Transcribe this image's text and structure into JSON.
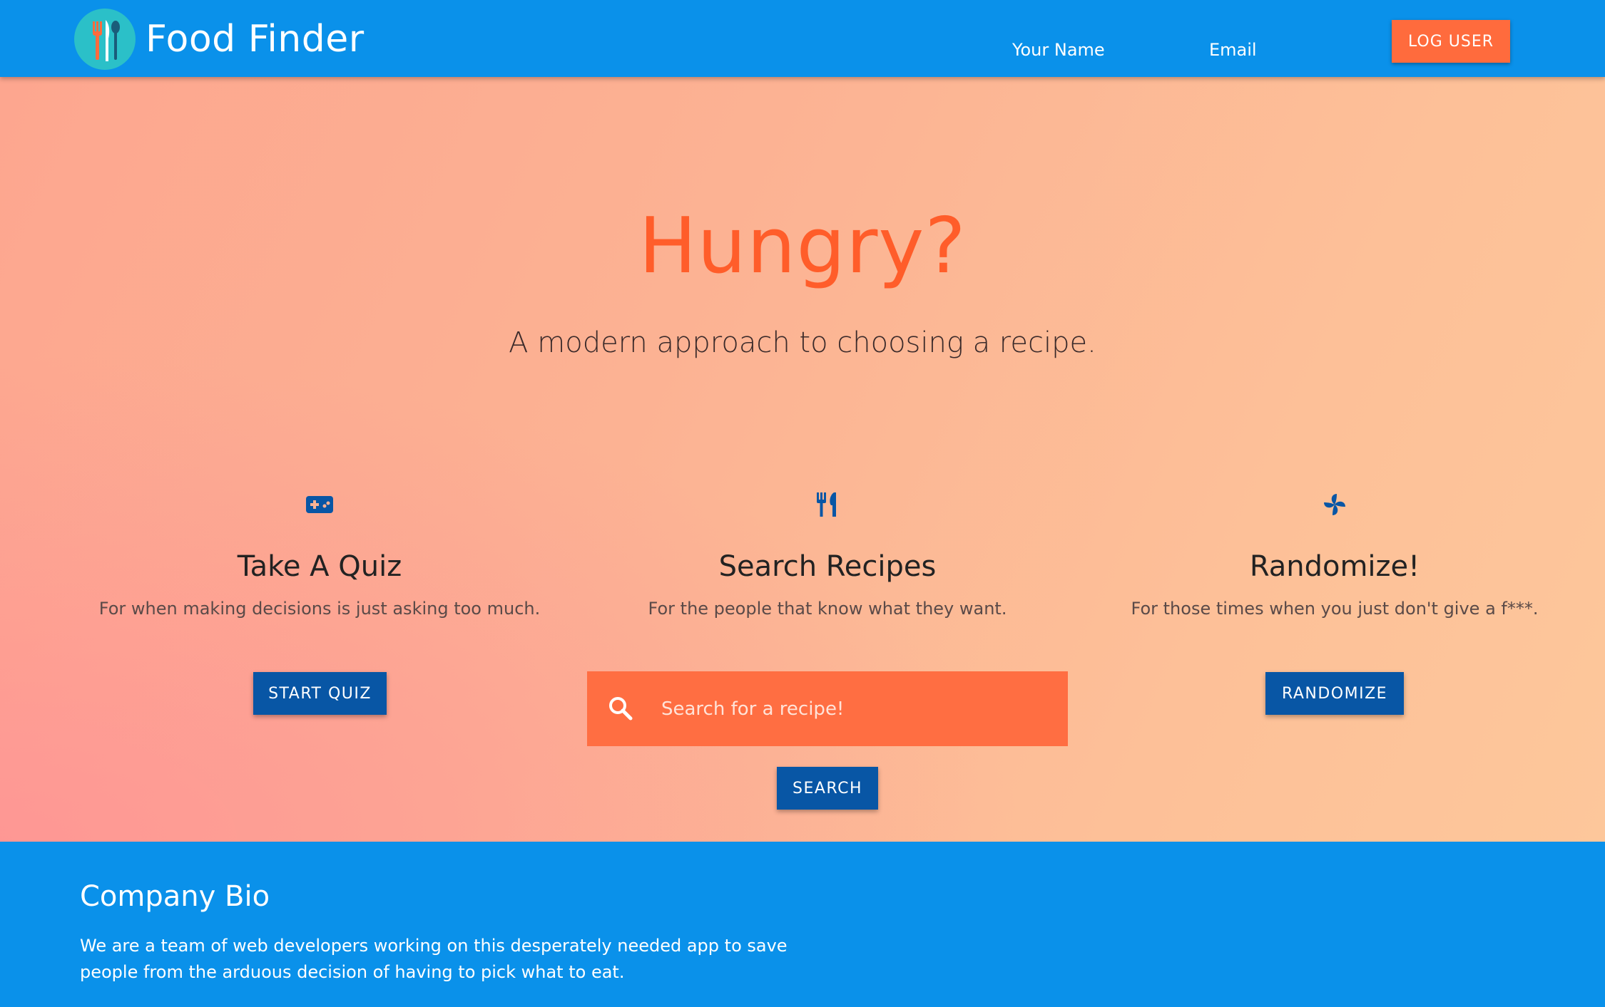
{
  "navbar": {
    "brand_name": "Food Finder",
    "name_placeholder": "Your Name",
    "email_placeholder": "Email",
    "log_button": "LOG USER"
  },
  "hero": {
    "title": "Hungry?",
    "subtitle": "A modern approach to choosing a recipe."
  },
  "features": {
    "quiz": {
      "icon": "gamepad-icon",
      "title": "Take A Quiz",
      "description": "For when making decisions is just asking too much.",
      "button": "START QUIZ"
    },
    "search": {
      "icon": "utensils-icon",
      "title": "Search Recipes",
      "description": "For the people that know what they want.",
      "input_placeholder": "Search for a recipe!",
      "input_value": "",
      "button": "SEARCH"
    },
    "random": {
      "icon": "pinwheel-icon",
      "title": "Randomize!",
      "description": "For those times when you just don't give a f***.",
      "button": "RANDOMIZE"
    }
  },
  "footer": {
    "title": "Company Bio",
    "text": "We are a team of web developers working on this desperately needed app to save people from the arduous decision of having to pick what to eat."
  },
  "colors": {
    "navbar": "#0a91ea",
    "accent_orange": "#ff6b3d",
    "button_blue": "#0856a5",
    "hero_title": "#ff5d2a"
  }
}
